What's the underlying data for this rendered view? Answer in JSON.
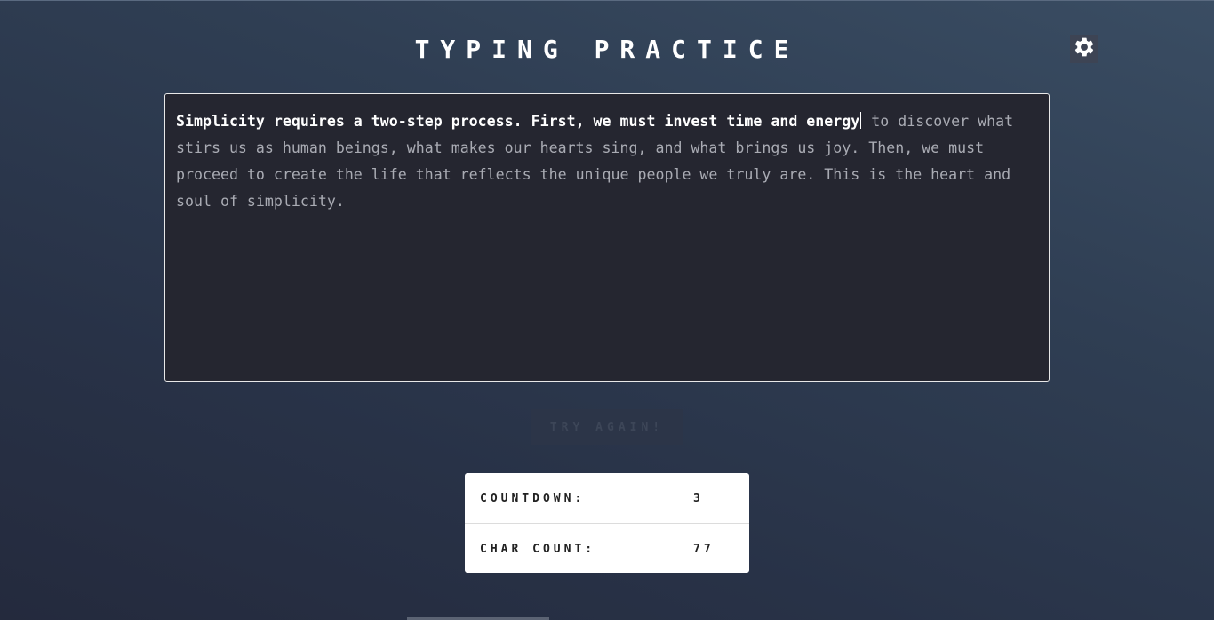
{
  "header": {
    "title": "TYPING PRACTICE",
    "settings_icon": "gear-icon"
  },
  "passage": {
    "typed": "Simplicity requires a two-step process. First, we must invest time and energy",
    "remaining": " to discover what stirs us as human beings, what makes our hearts sing, and what brings us joy. Then, we must proceed to create the life that reflects the unique people we truly are. This is the heart and soul of simplicity."
  },
  "actions": {
    "try_again_label": "TRY AGAIN!"
  },
  "stats": {
    "countdown_label": "COUNTDOWN:",
    "countdown_value": "3",
    "char_count_label": "CHAR COUNT:",
    "char_count_value": "77"
  },
  "colors": {
    "typed_text": "#ffffff",
    "untyped_text": "#a9abb3",
    "panel_background": "#252630",
    "stats_background": "#ffffff"
  }
}
